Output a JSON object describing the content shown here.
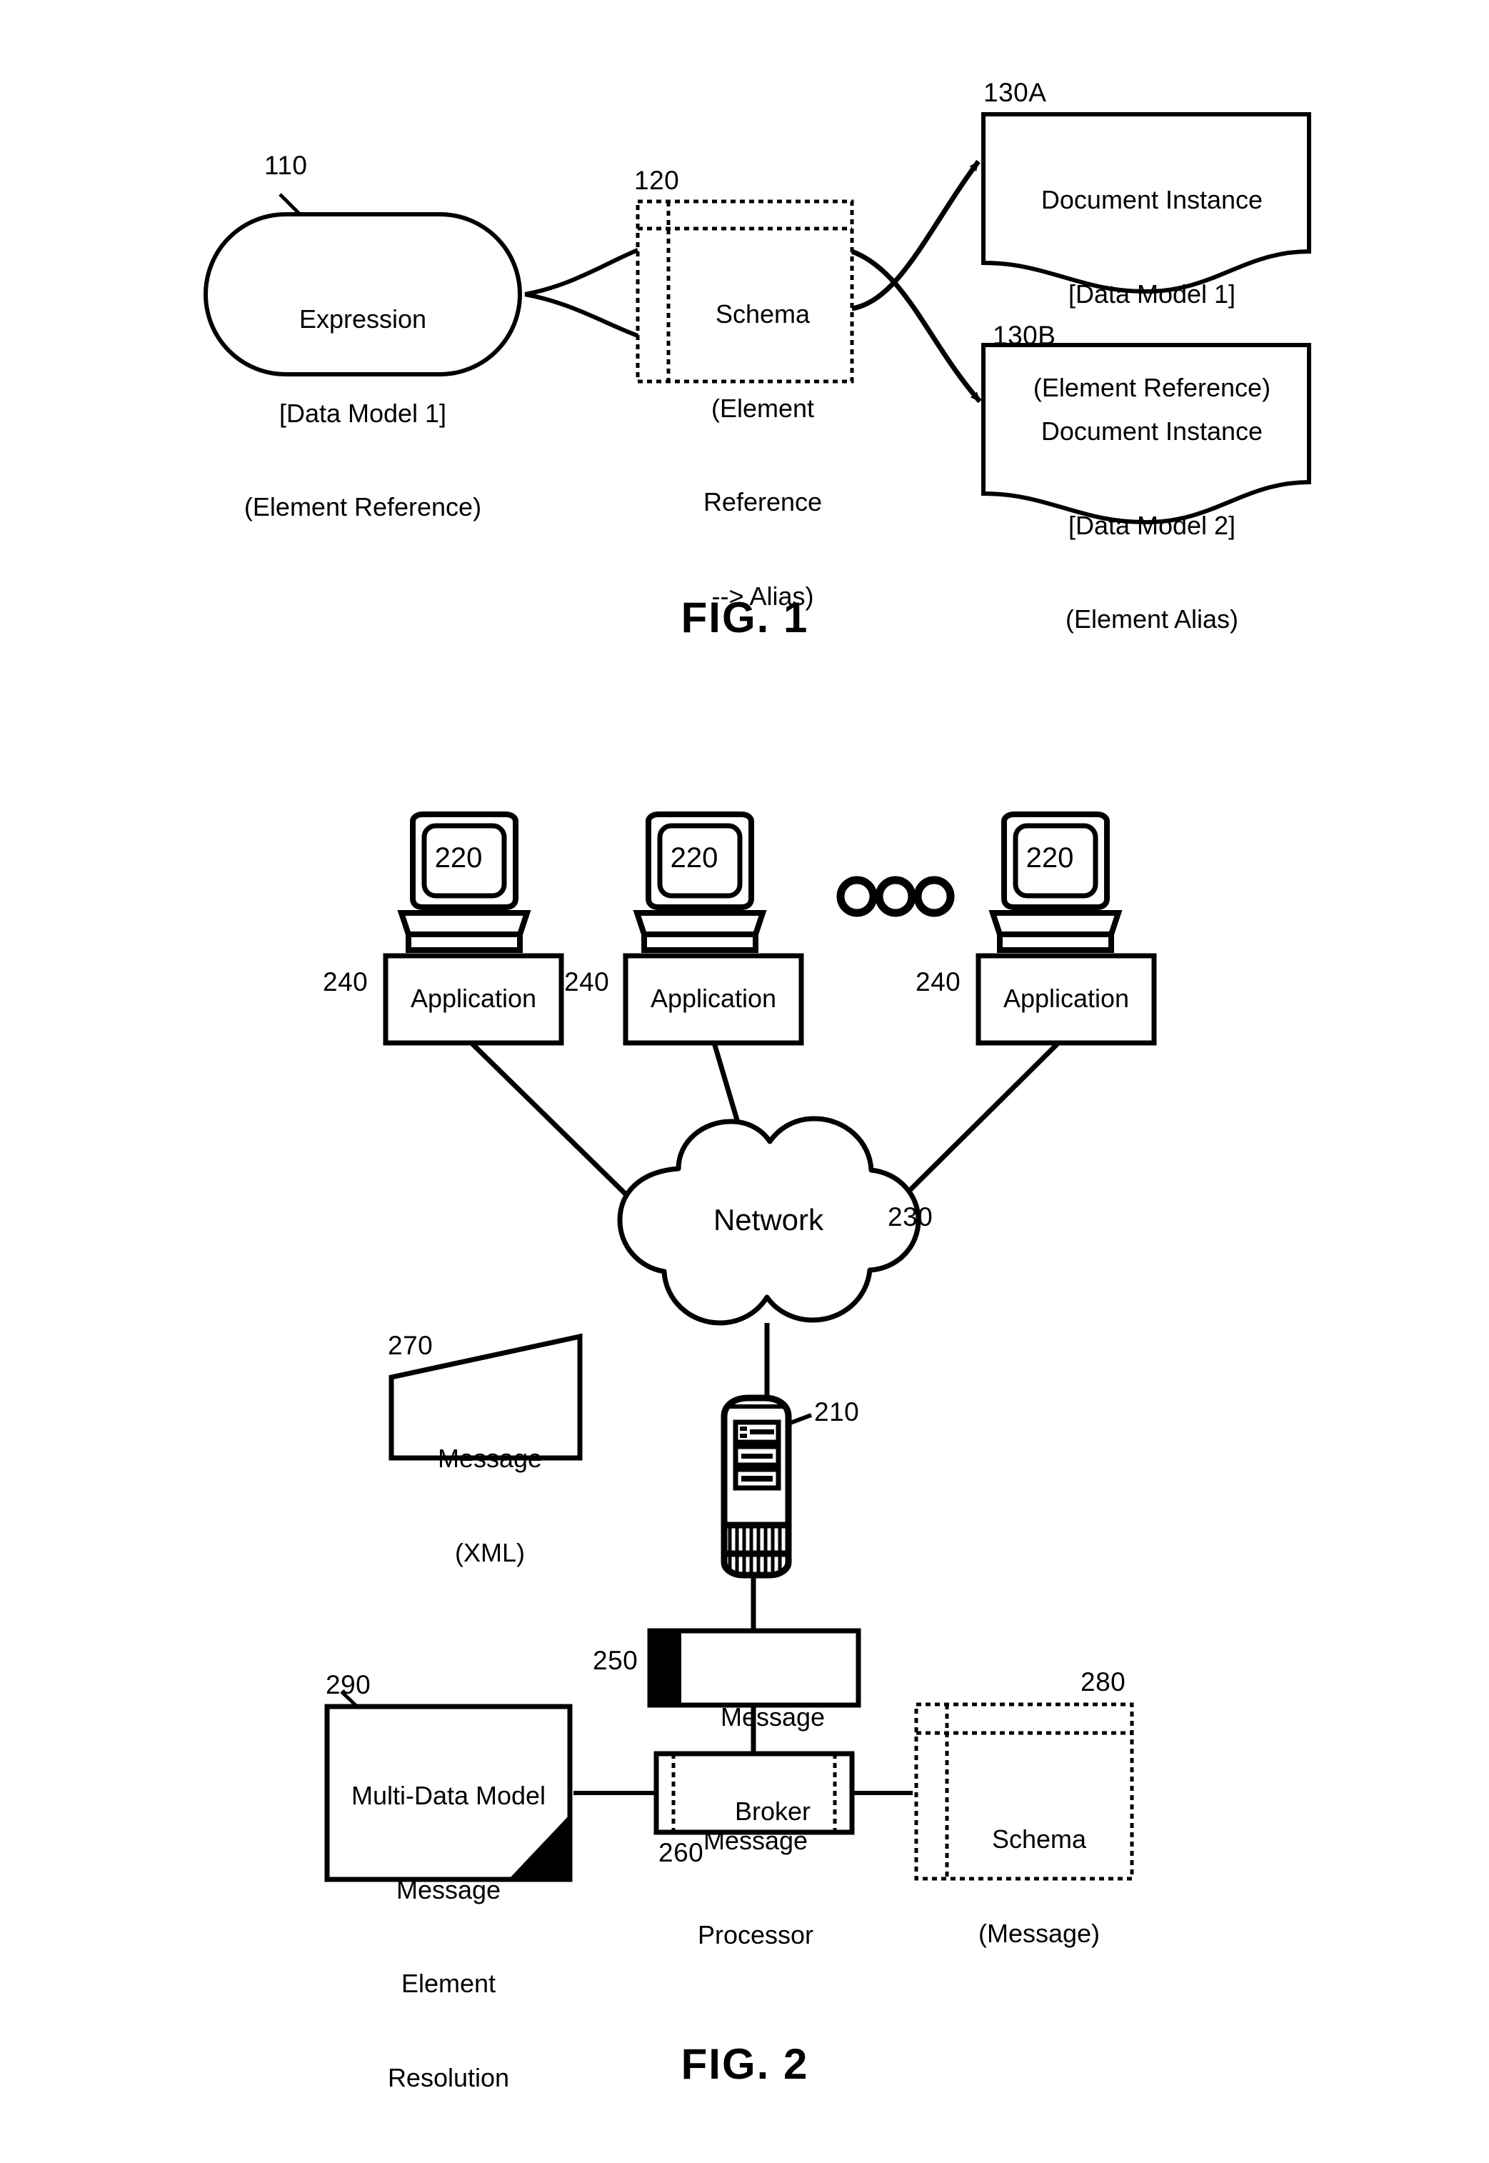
{
  "figures": [
    {
      "caption": "FIG. 1",
      "nodes": {
        "expression": {
          "ref": "110",
          "lines": [
            "Expression",
            "[Data Model 1]",
            "(Element Reference)"
          ],
          "shape": "rounded-ellipse"
        },
        "schema": {
          "ref": "120",
          "lines": [
            "Schema",
            "(Element",
            "Reference",
            "--> Alias)"
          ],
          "shape": "dashed-stack"
        },
        "document_a": {
          "ref": "130A",
          "lines": [
            "Document Instance",
            "[Data Model 1]",
            "(Element Reference)"
          ],
          "shape": "document-wave"
        },
        "document_b": {
          "ref": "130B",
          "lines": [
            "Document Instance",
            "[Data Model 2]",
            "(Element Alias)"
          ],
          "shape": "document-wave"
        }
      }
    },
    {
      "caption": "FIG. 2",
      "nodes": {
        "terminal_1": {
          "ref": "220",
          "shape": "computer-icon"
        },
        "terminal_2": {
          "ref": "220",
          "shape": "computer-icon"
        },
        "terminal_3": {
          "ref": "220",
          "shape": "computer-icon"
        },
        "ellipsis": {
          "glyph": "ooo",
          "shape": "three-circles"
        },
        "application_1": {
          "ref": "240",
          "lines": [
            "Application"
          ],
          "shape": "rect"
        },
        "application_2": {
          "ref": "240",
          "lines": [
            "Application"
          ],
          "shape": "rect"
        },
        "application_3": {
          "ref": "240",
          "lines": [
            "Application"
          ],
          "shape": "rect"
        },
        "network": {
          "ref": "230",
          "lines": [
            "Network"
          ],
          "shape": "cloud"
        },
        "message_xml": {
          "ref": "270",
          "lines": [
            "Message",
            "(XML)"
          ],
          "shape": "slanted-quad"
        },
        "server": {
          "ref": "210",
          "shape": "server-tower-icon"
        },
        "message_broker": {
          "ref": "250",
          "lines": [
            "Message",
            "Broker"
          ],
          "shape": "rect-black-bar"
        },
        "message_processor": {
          "ref": "260",
          "lines": [
            "Message",
            "Processor"
          ],
          "shape": "process-rect"
        },
        "schema_message": {
          "ref": "280",
          "lines": [
            "Schema",
            "(Message)"
          ],
          "shape": "dashed-stack"
        },
        "element_resolution": {
          "ref": "290",
          "lines": [
            "Multi-Data Model",
            "Message",
            "Element",
            "Resolution"
          ],
          "shape": "rect-black-corner"
        }
      }
    }
  ],
  "colors": {
    "ink": "#000000",
    "paper": "#ffffff"
  }
}
